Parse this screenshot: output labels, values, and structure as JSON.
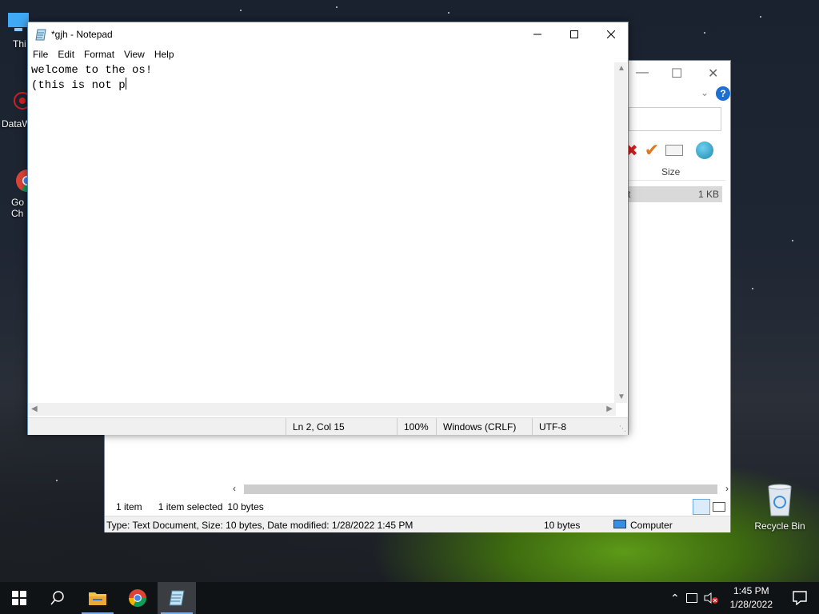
{
  "notepad": {
    "title": "*gjh - Notepad",
    "menu": [
      "File",
      "Edit",
      "Format",
      "View",
      "Help"
    ],
    "content": "welcome to the os!\n(this is not p",
    "status": {
      "position": "Ln 2, Col 15",
      "zoom": "100%",
      "line_ending": "Windows (CRLF)",
      "encoding": "UTF-8"
    }
  },
  "explorer": {
    "column_size": "Size",
    "row_name_fragment": "t",
    "row_size": "1 KB",
    "status": {
      "item_count": "1 item",
      "selected": "1 item selected",
      "selected_size": "10 bytes"
    },
    "details_bar": {
      "info": "Type: Text Document, Size: 10 bytes, Date modified: 1/28/2022 1:45 PM",
      "size": "10 bytes",
      "location": "Computer"
    }
  },
  "desktop": {
    "icons": [
      {
        "label": "Thi"
      },
      {
        "label": "DataW"
      },
      {
        "label": "Go\nCh"
      },
      {
        "label": "Recycle Bin"
      }
    ]
  },
  "taskbar": {
    "time": "1:45 PM",
    "date": "1/28/2022"
  },
  "colors": {
    "taskbar": "#101316",
    "accent": "#7aaee0",
    "help_blue": "#1e6fd0",
    "tick_orange": "#e07820",
    "delete_red": "#d02020"
  }
}
